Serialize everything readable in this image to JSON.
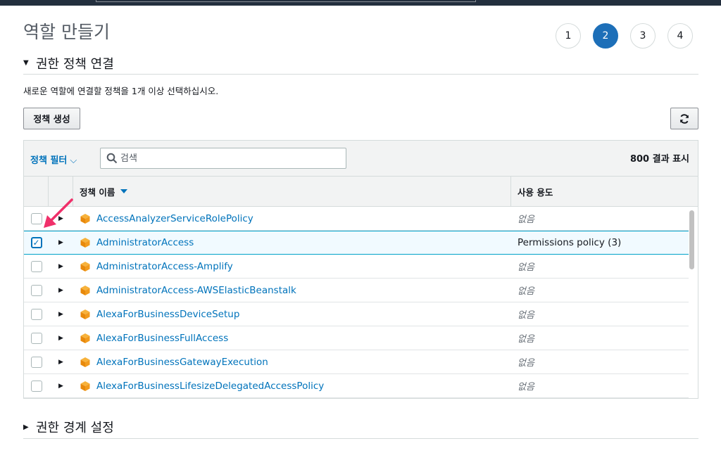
{
  "page": {
    "title": "역할 만들기"
  },
  "wizard": {
    "steps": [
      "1",
      "2",
      "3",
      "4"
    ],
    "active_step": "2"
  },
  "section_permissions": {
    "title": "권한 정책 연결",
    "expanded": true
  },
  "description": "새로운 역할에 연결할 정책을 1개 이상 선택하십시오.",
  "toolbar": {
    "create_policy_label": "정책 생성",
    "refresh_icon": "refresh-icon"
  },
  "filter": {
    "label": "정책 필터",
    "search_placeholder": "검색",
    "search_value": "",
    "result_count": "800 결과 표시"
  },
  "table": {
    "columns": {
      "name": "정책 이름",
      "usage": "사용 용도"
    },
    "sort": {
      "column": "정책 이름",
      "direction": "descending"
    },
    "rows": [
      {
        "name": "AccessAnalyzerServiceRolePolicy",
        "usage": "없음",
        "checked": false
      },
      {
        "name": "AdministratorAccess",
        "usage": "Permissions policy (3)",
        "checked": true
      },
      {
        "name": "AdministratorAccess-Amplify",
        "usage": "없음",
        "checked": false
      },
      {
        "name": "AdministratorAccess-AWSElasticBeanstalk",
        "usage": "없음",
        "checked": false
      },
      {
        "name": "AlexaForBusinessDeviceSetup",
        "usage": "없음",
        "checked": false
      },
      {
        "name": "AlexaForBusinessFullAccess",
        "usage": "없음",
        "checked": false
      },
      {
        "name": "AlexaForBusinessGatewayExecution",
        "usage": "없음",
        "checked": false
      },
      {
        "name": "AlexaForBusinessLifesizeDelegatedAccessPolicy",
        "usage": "없음",
        "checked": false
      }
    ]
  },
  "section_boundary": {
    "title": "권한 경계 설정",
    "expanded": false
  },
  "colors": {
    "accent": "#1d6fb8",
    "link": "#0073bb",
    "annotation_arrow": "#f0306a",
    "cube": "#f29b1d"
  }
}
